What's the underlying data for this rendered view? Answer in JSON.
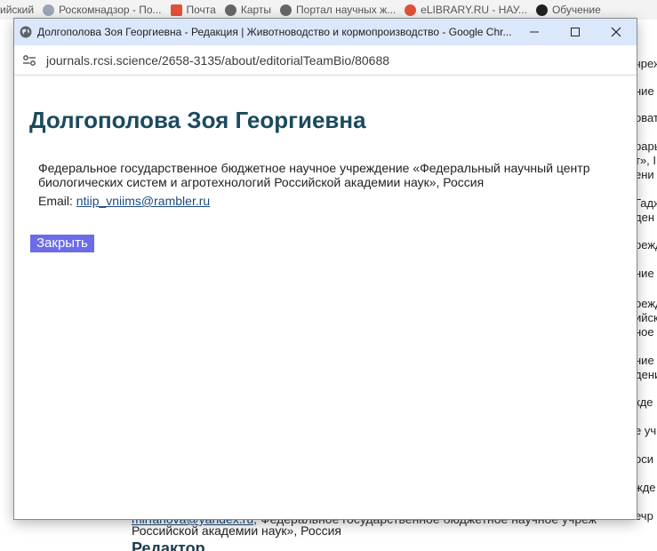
{
  "background": {
    "bookmarks": [
      {
        "label": "ийский",
        "icon": "none",
        "color": "#f3f3f3"
      },
      {
        "label": "Роскомнадзор - По...",
        "icon": "emblem-icon",
        "color": "#9aa6b8"
      },
      {
        "label": "Почта",
        "icon": "mail-icon",
        "color": "#e0513a"
      },
      {
        "label": "Карты",
        "icon": "globe-icon",
        "color": "#666666"
      },
      {
        "label": "Портал научных ж...",
        "icon": "globe-icon",
        "color": "#666666"
      },
      {
        "label": "eLIBRARY.RU - НАУ...",
        "icon": "elibrary-icon",
        "color": "#e0513a"
      },
      {
        "label": "Обучение",
        "icon": "openai-icon",
        "color": "#222222"
      }
    ],
    "right_text": [
      "чрежд",
      "ние",
      "оват",
      "рарь",
      "т», І",
      "ени",
      "Гадж",
      "ден",
      "режд",
      "ние «",
      "режд",
      "ийск",
      "ное",
      "ние",
      "дени",
      "кде",
      "е уч",
      "оси",
      "жде",
      "",
      "ечр"
    ],
    "bottom_link": "mirfanova@yandex.ru",
    "bottom_link_tail": ", Федеральное государственное бюджетное научное учреж",
    "bottom_line2": "Российской академии наук», Россия",
    "bottom_heading": "Редактор"
  },
  "window": {
    "title": "Долгополова Зоя Георгиевна - Редакция | Животноводство и кормопроизводство - Google Chr...",
    "url": "journals.rcsi.science/2658-3135/about/editorialTeamBio/80688"
  },
  "content": {
    "name": "Долгополова Зоя Георгиевна",
    "affiliation": "Федеральное государственное бюджетное научное учреждение «Федеральный научный центр биологических систем и агротехнологий Российской академии наук», Россия",
    "email_label": "Email: ",
    "email": "ntiip_vniims@rambler.ru",
    "close_label": "Закрыть"
  }
}
